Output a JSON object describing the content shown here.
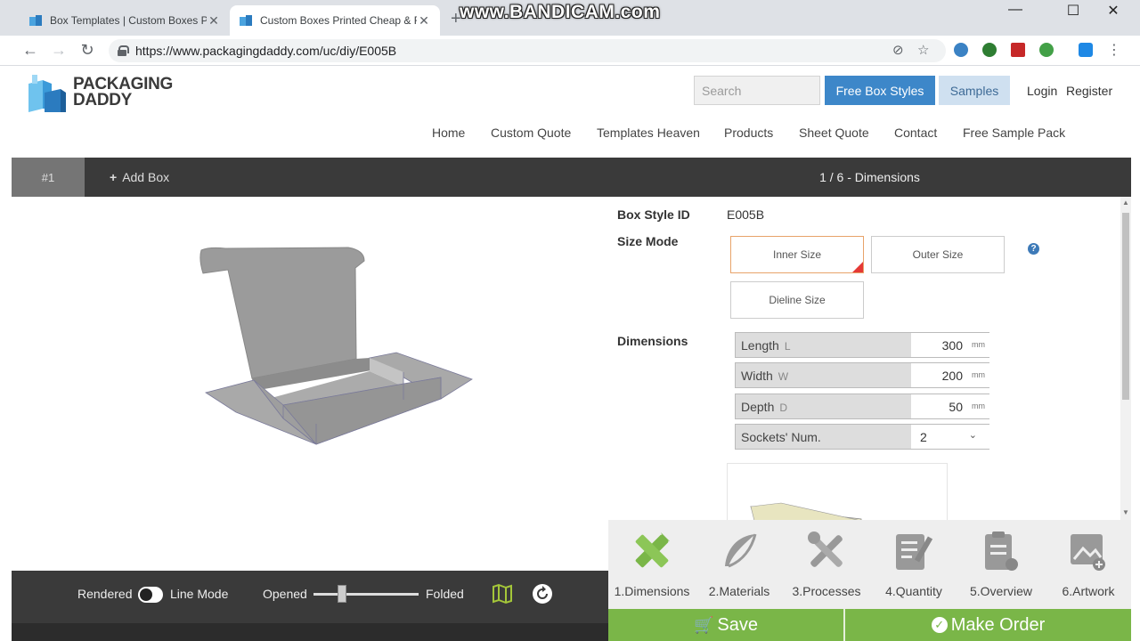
{
  "browser": {
    "tabs": [
      {
        "title": "Box Templates | Custom Boxes Pr",
        "active": false
      },
      {
        "title": "Custom Boxes Printed Cheap & F",
        "active": true
      }
    ],
    "new_tab_symbol": "+",
    "watermark": "www.BANDICAM.com",
    "url": "https://www.packagingdaddy.com/uc/diy/E005B",
    "window_controls": {
      "minimize": "—",
      "maximize": "☐",
      "close": "✕"
    },
    "tab_close": "✕"
  },
  "site": {
    "logo_line1": "PACKAGING",
    "logo_line2": "DADDY",
    "search_placeholder": "Search",
    "free_box_styles": "Free Box Styles",
    "samples": "Samples",
    "login": "Login",
    "register": "Register",
    "nav": [
      "Home",
      "Custom Quote",
      "Templates Heaven",
      "Products",
      "Sheet Quote",
      "Contact",
      "Free Sample Pack"
    ]
  },
  "left_panel": {
    "box_tab": "#1",
    "add_box": "Add Box",
    "rendered_label": "Rendered",
    "line_mode_label": "Line Mode",
    "opened_label": "Opened",
    "folded_label": "Folded",
    "fold_slider_level": 0.27
  },
  "right_panel": {
    "step_title": "1 / 6 - Dimensions",
    "box_style_label": "Box Style ID",
    "box_style_value": "E005B",
    "size_mode_label": "Size Mode",
    "size_modes": [
      "Inner Size",
      "Outer Size",
      "Dieline Size"
    ],
    "selected_size_mode": "Inner Size",
    "dimensions_label": "Dimensions",
    "dimensions": [
      {
        "label": "Length",
        "symbol": "L",
        "value": "300",
        "unit": "mm"
      },
      {
        "label": "Width",
        "symbol": "W",
        "value": "200",
        "unit": "mm"
      },
      {
        "label": "Depth",
        "symbol": "D",
        "value": "50",
        "unit": "mm"
      }
    ],
    "sockets_label": "Sockets' Num.",
    "sockets_value": "2",
    "help_symbol": "?"
  },
  "steps": [
    {
      "label": "1.Dimensions",
      "icon": "ruler-pencil-icon",
      "active": true
    },
    {
      "label": "2.Materials",
      "icon": "feather-icon",
      "active": false
    },
    {
      "label": "3.Processes",
      "icon": "tools-icon",
      "active": false
    },
    {
      "label": "4.Quantity",
      "icon": "edit-list-icon",
      "active": false
    },
    {
      "label": "5.Overview",
      "icon": "clipboard-icon",
      "active": false
    },
    {
      "label": "6.Artwork",
      "icon": "image-add-icon",
      "active": false
    }
  ],
  "actions": {
    "save": "Save",
    "make_order": "Make Order"
  },
  "colors": {
    "accent_blue": "#3d87c9",
    "action_green": "#7ab648",
    "active_step_green": "#7ab648",
    "dark_bar": "#3a3a3a"
  }
}
